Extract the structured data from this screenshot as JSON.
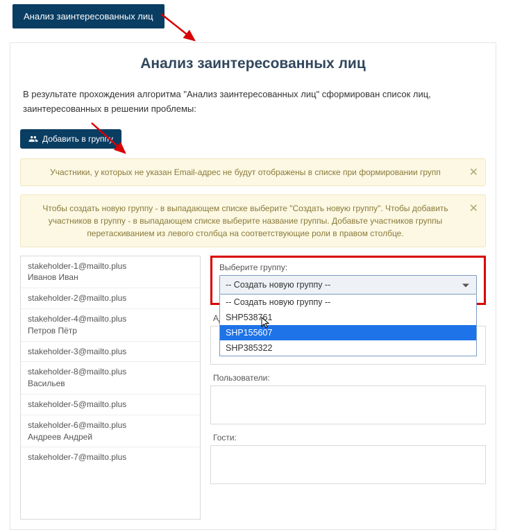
{
  "tab_label": "Анализ заинтересованных лиц",
  "page_title": "Анализ заинтересованных лиц",
  "intro": "В результате прохождения алгоритма \"Анализ заинтересованных лиц\" сформирован список лиц, заинтересованных в решении проблемы:",
  "add_button": "Добавить в группу",
  "alert1": "Участники, у которых не указан Email-адрес не будут отображены в списке при формировании групп",
  "alert2": "Чтобы создать новую группу - в выпадающем списке выберите \"Создать новую группу\". Чтобы добавить участников в группу - в выпадающем списке выберите название группы. Добавьте участников группы перетаскиванием из левого столбца на соответствующие роли в правом столбце.",
  "stakeholders": [
    {
      "email": "stakeholder-1@mailto.plus",
      "name": "Иванов Иван"
    },
    {
      "email": "stakeholder-2@mailto.plus",
      "name": ""
    },
    {
      "email": "stakeholder-4@mailto.plus",
      "name": "Петров Пётр"
    },
    {
      "email": "stakeholder-3@mailto.plus",
      "name": ""
    },
    {
      "email": "stakeholder-8@mailto.plus",
      "name": "Васильев"
    },
    {
      "email": "stakeholder-5@mailto.plus",
      "name": ""
    },
    {
      "email": "stakeholder-6@mailto.plus",
      "name": "Андреев Андрей"
    },
    {
      "email": "stakeholder-7@mailto.plus",
      "name": ""
    }
  ],
  "group_select": {
    "label": "Выберите группу:",
    "selected": "-- Создать новую группу --",
    "options": [
      "-- Создать новую группу --",
      "SHP538761",
      "SHP155607",
      "SHP385322"
    ],
    "highlighted_index": 2
  },
  "labels": {
    "admin": "Администратор группы:",
    "users": "Пользователи:",
    "guests": "Гости:"
  }
}
